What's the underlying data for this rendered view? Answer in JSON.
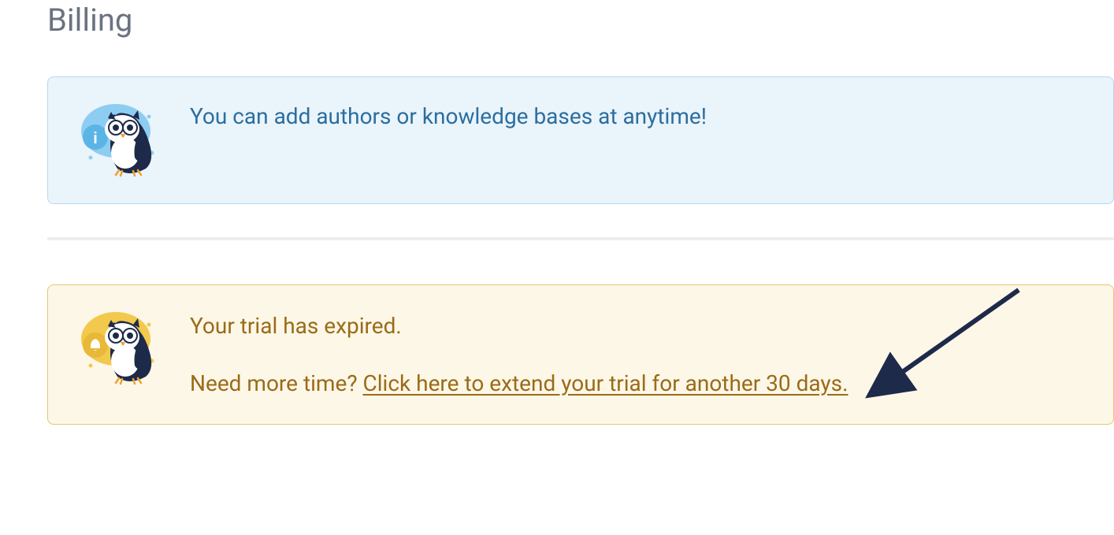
{
  "page": {
    "title": "Billing"
  },
  "info_alert": {
    "message": "You can add authors or knowledge bases at anytime!",
    "icon": "owl-info-icon"
  },
  "warning_alert": {
    "title": "Your trial has expired.",
    "subtext_prefix": "Need more time? ",
    "link_text": "Click here to extend your trial for another 30 days.",
    "icon": "owl-bell-icon"
  },
  "colors": {
    "info_bg": "#eaf4fb",
    "info_border": "#b6d9ef",
    "info_text": "#2b6e9e",
    "warning_bg": "#fdf7e8",
    "warning_border": "#e5c66f",
    "warning_text": "#9a6b17",
    "arrow": "#1e2a4a"
  }
}
